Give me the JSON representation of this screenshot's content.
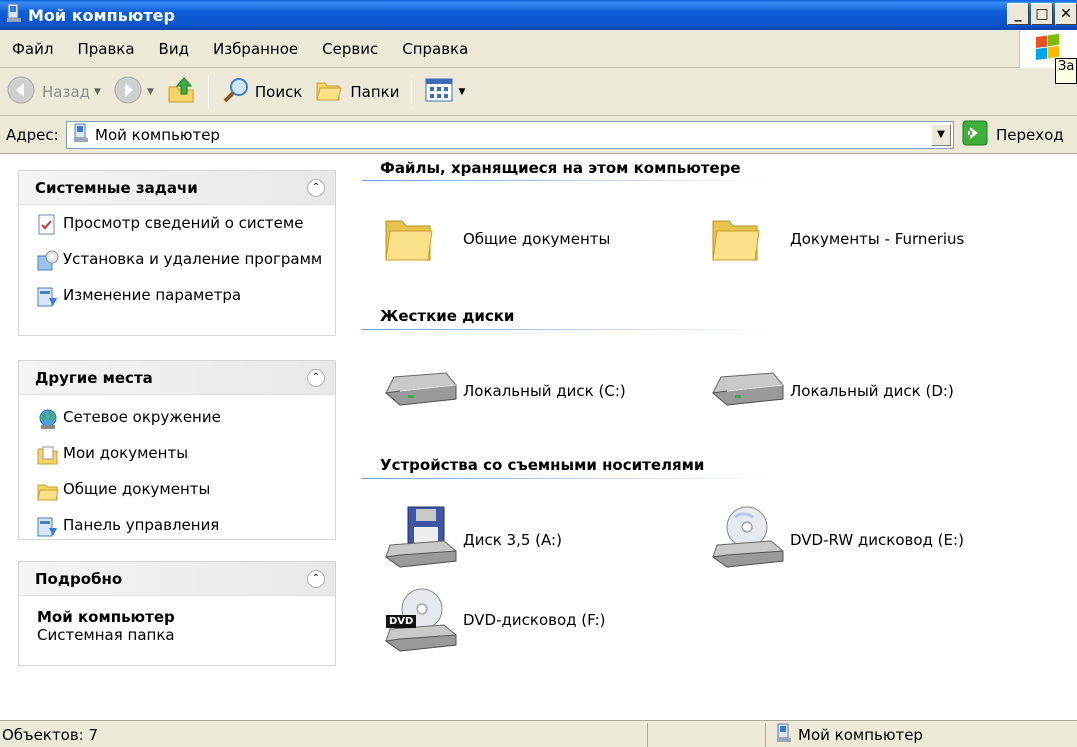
{
  "window": {
    "title": "Мой компьютер",
    "minimize": "_",
    "maximize": "□",
    "close": "✕"
  },
  "menu": [
    "Файл",
    "Правка",
    "Вид",
    "Избранное",
    "Сервис",
    "Справка"
  ],
  "tooltip": "За",
  "toolbar": {
    "back": "Назад",
    "search": "Поиск",
    "folders": "Папки"
  },
  "address": {
    "label": "Адрес:",
    "value": "Мой компьютер",
    "go": "Переход"
  },
  "tasks_panel": {
    "title": "Системные задачи",
    "items": [
      "Просмотр сведений о системе",
      "Установка и удаление программ",
      "Изменение параметра"
    ]
  },
  "places_panel": {
    "title": "Другие места",
    "items": [
      "Сетевое окружение",
      "Мои документы",
      "Общие документы",
      "Панель управления"
    ]
  },
  "details_panel": {
    "title": "Подробно",
    "name": "Мой компьютер",
    "type": "Системная папка"
  },
  "groups": {
    "files": {
      "title": "Файлы, хранящиеся на этом компьютере",
      "items": [
        "Общие документы",
        "Документы - Furnerius"
      ]
    },
    "disks": {
      "title": "Жесткие диски",
      "items": [
        "Локальный диск (C:)",
        "Локальный диск (D:)"
      ]
    },
    "removable": {
      "title": "Устройства со съемными носителями",
      "items": [
        "Диск 3,5 (A:)",
        "DVD-RW дисковод (E:)",
        "DVD-дисковод (F:)"
      ]
    }
  },
  "dvd_badge": "DVD",
  "status": {
    "objects": "Объектов: 7",
    "location": "Мой компьютер"
  }
}
